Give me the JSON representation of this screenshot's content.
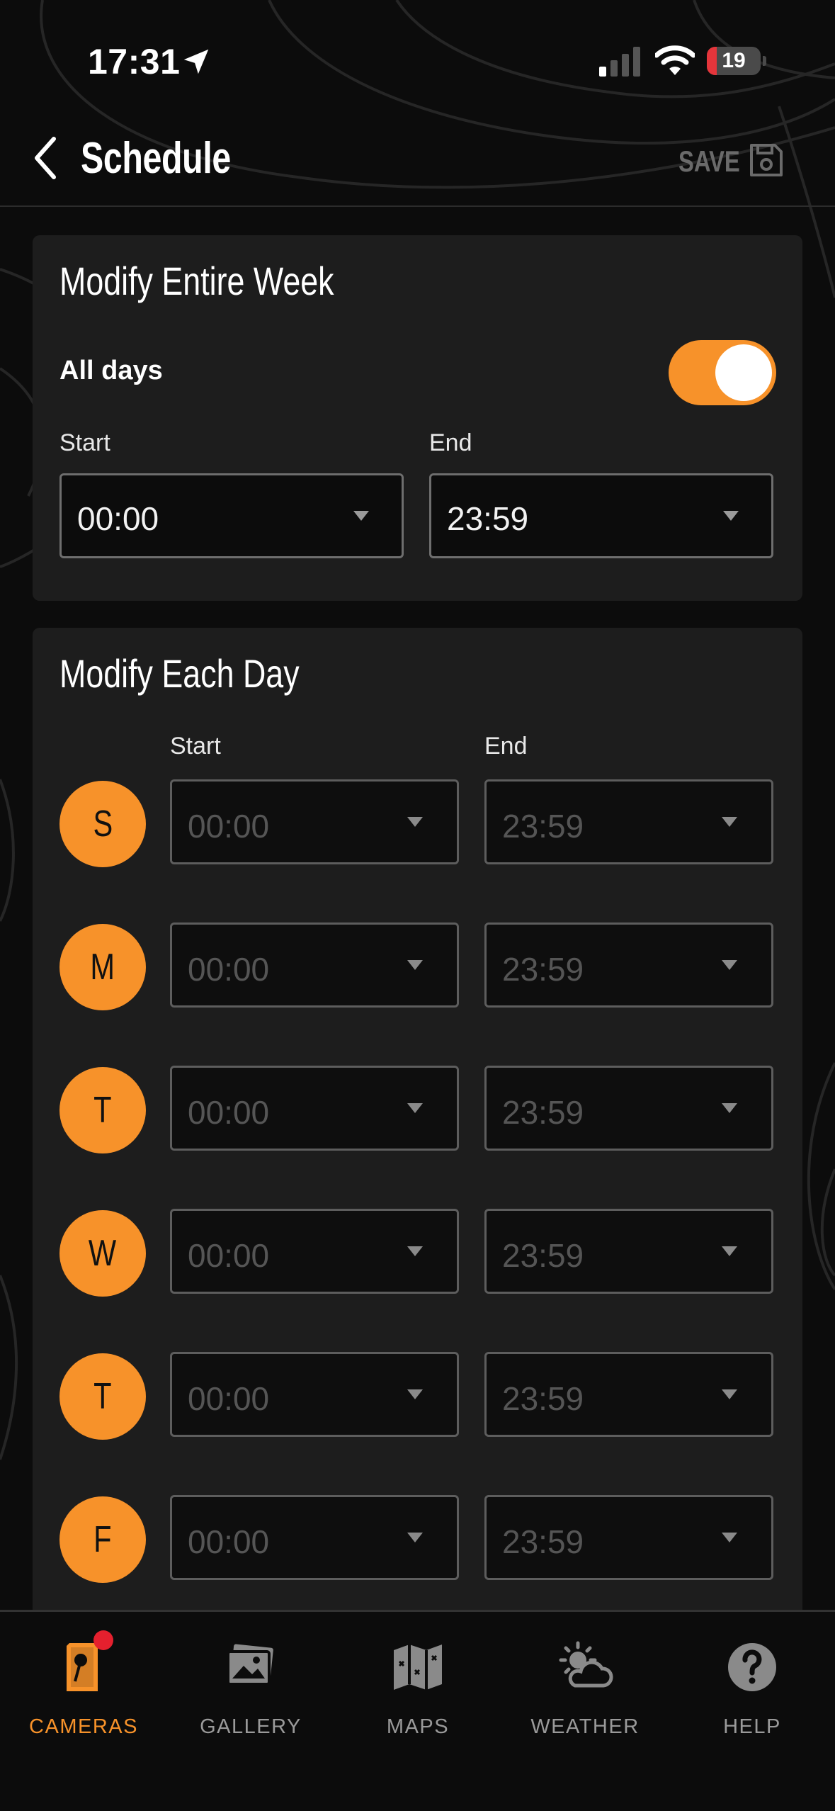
{
  "status_bar": {
    "time": "17:31",
    "battery": "19",
    "battery_level": 0.19
  },
  "header": {
    "title": "Schedule",
    "save_label": "SAVE"
  },
  "week": {
    "title": "Modify Entire Week",
    "all_days_label": "All days",
    "all_days_enabled": true,
    "start_label": "Start",
    "end_label": "End",
    "start_value": "00:00",
    "end_value": "23:59"
  },
  "each_day": {
    "title": "Modify Each Day",
    "start_label": "Start",
    "end_label": "End",
    "days": [
      {
        "letter": "S",
        "start": "00:00",
        "end": "23:59"
      },
      {
        "letter": "M",
        "start": "00:00",
        "end": "23:59"
      },
      {
        "letter": "T",
        "start": "00:00",
        "end": "23:59"
      },
      {
        "letter": "W",
        "start": "00:00",
        "end": "23:59"
      },
      {
        "letter": "T",
        "start": "00:00",
        "end": "23:59"
      },
      {
        "letter": "F",
        "start": "00:00",
        "end": "23:59"
      }
    ]
  },
  "tabbar": {
    "active_color": "#f7922a",
    "tabs": [
      {
        "label": "CAMERAS",
        "icon": "camera-icon",
        "active": true,
        "badge": true
      },
      {
        "label": "GALLERY",
        "icon": "gallery-icon",
        "active": false
      },
      {
        "label": "MAPS",
        "icon": "map-icon",
        "active": false
      },
      {
        "label": "WEATHER",
        "icon": "weather-icon",
        "active": false
      },
      {
        "label": "HELP",
        "icon": "help-icon",
        "active": false
      }
    ]
  }
}
